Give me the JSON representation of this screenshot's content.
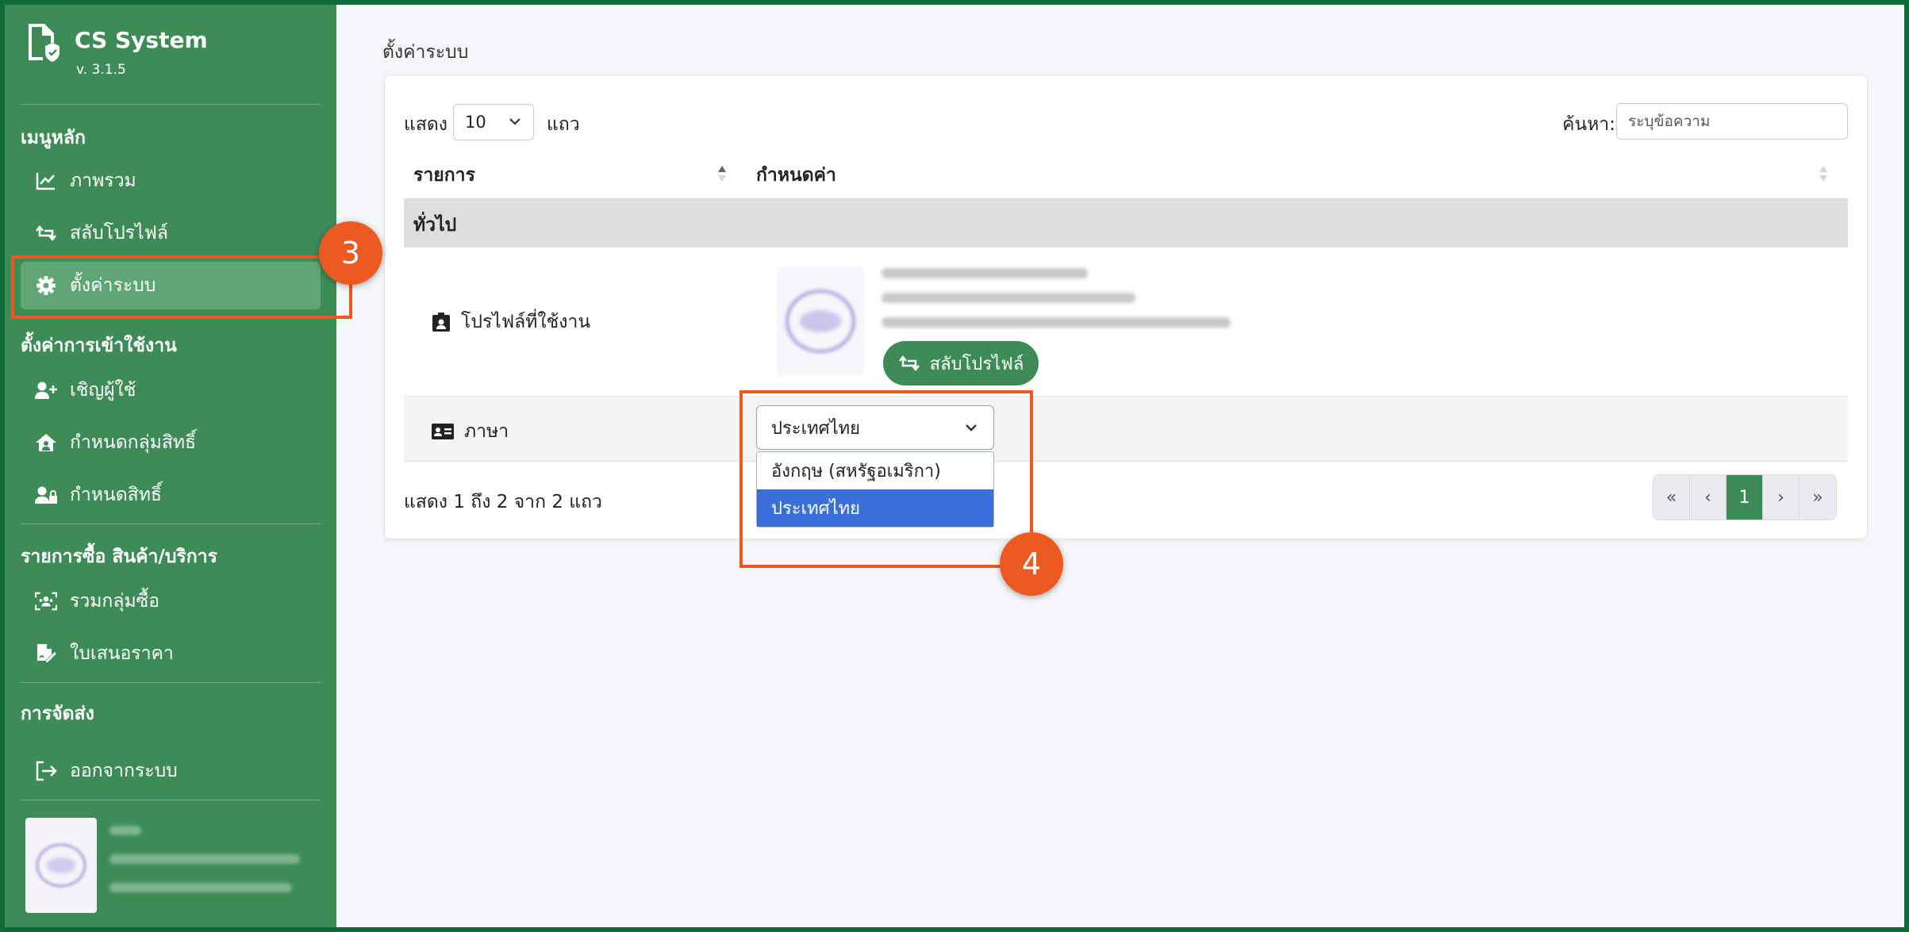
{
  "app": {
    "name": "CS System",
    "version": "v. 3.1.5"
  },
  "sidebar": {
    "sections": [
      {
        "title": "เมนูหลัก",
        "items": [
          {
            "label": "ภาพรวม",
            "icon": "chart-line-icon"
          },
          {
            "label": "สลับโปรไฟล์",
            "icon": "repeat-icon"
          },
          {
            "label": "ตั้งค่าระบบ",
            "icon": "gear-icon",
            "active": true
          }
        ]
      },
      {
        "title": "ตั้งค่าการเข้าใช้งาน",
        "items": [
          {
            "label": "เชิญผู้ใช้",
            "icon": "user-plus-icon"
          },
          {
            "label": "กำหนดกลุ่มสิทธิ์",
            "icon": "house-user-icon"
          },
          {
            "label": "กำหนดสิทธิ์",
            "icon": "user-lock-icon"
          }
        ]
      },
      {
        "title": "รายการซื้อ สินค้า/บริการ",
        "items": [
          {
            "label": "รวมกลุ่มซื้อ",
            "icon": "group-scan-icon"
          },
          {
            "label": "ใบเสนอราคา",
            "icon": "file-signature-icon"
          }
        ]
      },
      {
        "title": "การจัดส่ง",
        "items": [
          {
            "label": "ออกจากระบบ",
            "icon": "sign-out-icon"
          }
        ]
      }
    ]
  },
  "page": {
    "title": "ตั้งค่าระบบ"
  },
  "table": {
    "show_label": "แสดง",
    "rows_label": "แถว",
    "page_length": "10",
    "search_label": "ค้นหา:",
    "search_placeholder": "ระบุข้อความ",
    "columns": [
      "รายการ",
      "กำหนดค่า"
    ],
    "group": "ทั่วไป",
    "rows": [
      {
        "label": "โปรไฟล์ที่ใช้งาน",
        "icon": "id-badge-icon",
        "button": "สลับโปรไฟล์"
      },
      {
        "label": "ภาษา",
        "icon": "id-card-icon",
        "select_value": "ประเทศไทย"
      }
    ],
    "language_options": [
      "อังกฤษ (สหรัฐอเมริกา)",
      "ประเทศไทย"
    ],
    "info": "แสดง 1 ถึง 2 จาก 2 แถว",
    "pagination": [
      "«",
      "‹",
      "1",
      "›",
      "»"
    ]
  },
  "annotations": [
    "3",
    "4"
  ],
  "colors": {
    "sidebar": "#3d8c57",
    "accent": "#ec5a22",
    "selected": "#3a6fd8"
  }
}
